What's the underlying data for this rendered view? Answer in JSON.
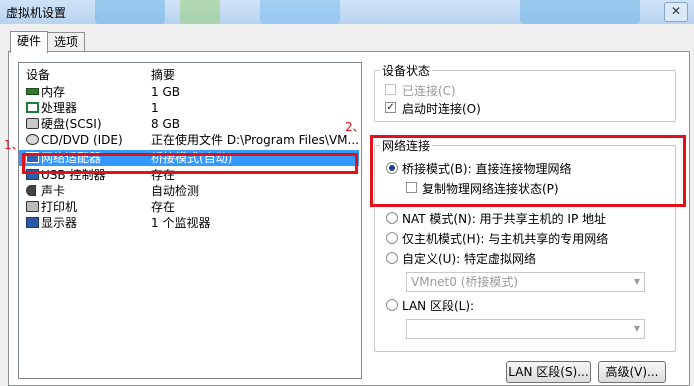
{
  "window": {
    "title": "虚拟机设置",
    "close_label": "✕"
  },
  "tabs": [
    {
      "label": "硬件"
    },
    {
      "label": "选项"
    }
  ],
  "device_list": {
    "col_device": "设备",
    "col_summary": "摘要",
    "rows": [
      {
        "name": "内存",
        "summary": "1 GB",
        "icon": "memory-icon"
      },
      {
        "name": "处理器",
        "summary": "1",
        "icon": "processor-icon"
      },
      {
        "name": "硬盘(SCSI)",
        "summary": "8 GB",
        "icon": "hard-disk-icon"
      },
      {
        "name": "CD/DVD (IDE)",
        "summary": "正在使用文件 D:\\Program Files\\VM...",
        "icon": "cd-dvd-icon"
      },
      {
        "name": "网络适配器",
        "summary": "桥接模式(自动)",
        "icon": "network-adapter-icon"
      },
      {
        "name": "USB 控制器",
        "summary": "存在",
        "icon": "usb-icon"
      },
      {
        "name": "声卡",
        "summary": "自动检测",
        "icon": "sound-card-icon"
      },
      {
        "name": "打印机",
        "summary": "存在",
        "icon": "printer-icon"
      },
      {
        "name": "显示器",
        "summary": "1 个监视器",
        "icon": "monitor-icon"
      }
    ],
    "selected_index": 4
  },
  "device_status": {
    "legend": "设备状态",
    "connected": {
      "label": "已连接(C)",
      "checked": false,
      "disabled": true
    },
    "connect_on_start": {
      "label": "启动时连接(O)",
      "checked": true
    }
  },
  "network": {
    "legend": "网络连接",
    "bridged": {
      "label": "桥接模式(B): 直接连接物理网络",
      "selected": true
    },
    "replicate": {
      "label": "复制物理网络连接状态(P)",
      "checked": false
    },
    "nat": {
      "label": "NAT 模式(N): 用于共享主机的 IP 地址"
    },
    "host_only": {
      "label": "仅主机模式(H): 与主机共享的专用网络"
    },
    "custom": {
      "label": "自定义(U): 特定虚拟网络"
    },
    "vmnet_select": {
      "value": "VMnet0 (桥接模式)"
    },
    "lan_segment": {
      "label": "LAN 区段(L):"
    },
    "lan_select": {
      "value": ""
    }
  },
  "buttons": {
    "lan_segments": "LAN 区段(S)...",
    "advanced": "高级(V)..."
  },
  "annotations": {
    "marker1": "1、",
    "marker2": "2、"
  },
  "colors": {
    "selection": "#3399ff",
    "highlight_box": "#e3101a"
  }
}
